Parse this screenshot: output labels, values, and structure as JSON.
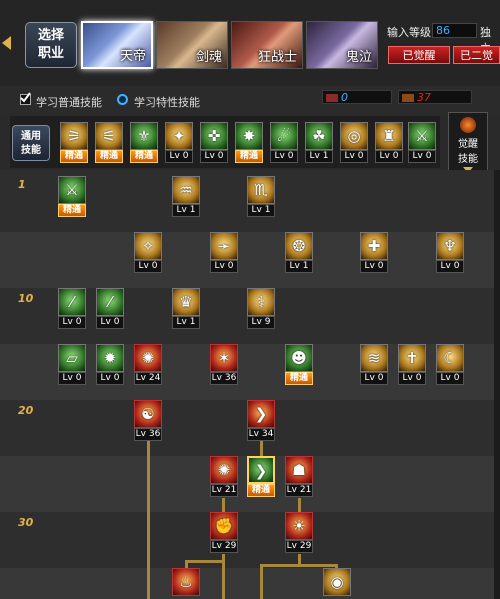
{
  "header": {
    "class_button": {
      "line1": "选择",
      "line2": "职业"
    },
    "portraits": [
      {
        "name": "天帝",
        "selected": true,
        "color": "#6a86c8"
      },
      {
        "name": "剑魂",
        "selected": false,
        "color": "#8a6a52"
      },
      {
        "name": "狂战士",
        "selected": false,
        "color": "#9a4a3a"
      },
      {
        "name": "鬼泣",
        "selected": false,
        "color": "#6a5a8a"
      }
    ],
    "level_label": "输入等级",
    "level_value": "86",
    "solo_label": "独立",
    "buttons": [
      "已觉醒",
      "已二觉"
    ]
  },
  "options": {
    "normal_label": "学习普通技能",
    "special_label": "学习特性技能",
    "sp_value": "0",
    "tp_value": "37"
  },
  "common": {
    "label_line1": "通用",
    "label_line2": "技能",
    "awake_line1": "觉醒",
    "awake_line2": "技能",
    "skills": [
      {
        "lv": "精通",
        "master": true,
        "kind": "gold",
        "glyph": "⚞"
      },
      {
        "lv": "精通",
        "master": true,
        "kind": "gold",
        "glyph": "⚟"
      },
      {
        "lv": "精通",
        "master": true,
        "kind": "green",
        "glyph": "⚜"
      },
      {
        "lv": "Lv 0",
        "master": false,
        "kind": "gold",
        "glyph": "✦"
      },
      {
        "lv": "Lv 0",
        "master": false,
        "kind": "green",
        "glyph": "✜"
      },
      {
        "lv": "精通",
        "master": true,
        "kind": "green",
        "glyph": "✸"
      },
      {
        "lv": "Lv 0",
        "master": false,
        "kind": "green",
        "glyph": "☄"
      },
      {
        "lv": "Lv 1",
        "master": false,
        "kind": "green",
        "glyph": "☘"
      },
      {
        "lv": "Lv 0",
        "master": false,
        "kind": "gold",
        "glyph": "◎"
      },
      {
        "lv": "Lv 0",
        "master": false,
        "kind": "gold",
        "glyph": "♜"
      },
      {
        "lv": "Lv 0",
        "master": false,
        "kind": "green",
        "glyph": "⚔"
      }
    ]
  },
  "rows": [
    "1",
    "10",
    "20",
    "30"
  ],
  "tree": [
    {
      "lv": "精通",
      "master": true,
      "kind": "green",
      "glyph": "⚔"
    },
    {
      "lv": "Lv 1",
      "master": false,
      "kind": "gold",
      "glyph": "♒"
    },
    {
      "lv": "Lv 1",
      "master": false,
      "kind": "gold",
      "glyph": "♏"
    },
    {
      "lv": "Lv 0",
      "master": false,
      "kind": "gold",
      "glyph": "✧"
    },
    {
      "lv": "Lv 0",
      "master": false,
      "kind": "gold",
      "glyph": "➛"
    },
    {
      "lv": "Lv 1",
      "master": false,
      "kind": "gold",
      "glyph": "❂"
    },
    {
      "lv": "Lv 0",
      "master": false,
      "kind": "gold",
      "glyph": "✚"
    },
    {
      "lv": "Lv 0",
      "master": false,
      "kind": "gold",
      "glyph": "♆"
    },
    {
      "lv": "Lv 0",
      "master": false,
      "kind": "green",
      "glyph": "⁄"
    },
    {
      "lv": "Lv 0",
      "master": false,
      "kind": "green",
      "glyph": "⁄"
    },
    {
      "lv": "Lv 1",
      "master": false,
      "kind": "gold",
      "glyph": "♛"
    },
    {
      "lv": "Lv 9",
      "master": false,
      "kind": "gold",
      "glyph": "⚕"
    },
    {
      "lv": "Lv 0",
      "master": false,
      "kind": "green",
      "glyph": "▱"
    },
    {
      "lv": "Lv 0",
      "master": false,
      "kind": "green",
      "glyph": "✹"
    },
    {
      "lv": "Lv 24",
      "master": false,
      "kind": "red",
      "glyph": "✺"
    },
    {
      "lv": "Lv 36",
      "master": false,
      "kind": "red",
      "glyph": "✶"
    },
    {
      "lv": "精通",
      "master": true,
      "kind": "green",
      "glyph": "☻"
    },
    {
      "lv": "Lv 0",
      "master": false,
      "kind": "gold",
      "glyph": "≋"
    },
    {
      "lv": "Lv 0",
      "master": false,
      "kind": "gold",
      "glyph": "✝"
    },
    {
      "lv": "Lv 0",
      "master": false,
      "kind": "gold",
      "glyph": "☾"
    },
    {
      "lv": "Lv 36",
      "master": false,
      "kind": "red",
      "glyph": "☯"
    },
    {
      "lv": "Lv 34",
      "master": false,
      "kind": "red",
      "glyph": "❯"
    },
    {
      "lv": "Lv 21",
      "master": false,
      "kind": "red",
      "glyph": "✺"
    },
    {
      "lv": "精通",
      "master": true,
      "kind": "green",
      "glyph": "❯"
    },
    {
      "lv": "Lv 21",
      "master": false,
      "kind": "red",
      "glyph": "☗"
    },
    {
      "lv": "Lv 29",
      "master": false,
      "kind": "red",
      "glyph": "✊"
    },
    {
      "lv": "Lv 29",
      "master": false,
      "kind": "red",
      "glyph": "☀"
    },
    {
      "lv": "",
      "master": false,
      "kind": "red",
      "glyph": "♨"
    },
    {
      "lv": "",
      "master": false,
      "kind": "gold",
      "glyph": "◉"
    }
  ]
}
